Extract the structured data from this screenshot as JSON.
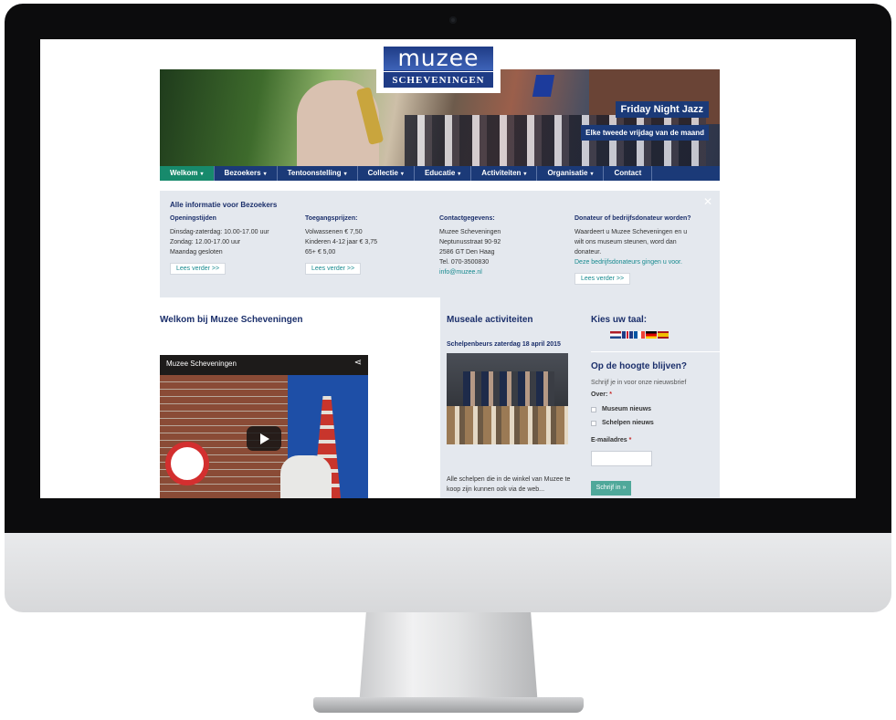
{
  "logo": {
    "word": "muzee",
    "sub": "SCHEVENINGEN"
  },
  "header": {
    "caption_title": "Friday Night Jazz",
    "caption_sub": "Elke tweede vrijdag van de maand"
  },
  "nav": {
    "items": [
      {
        "label": "Welkom",
        "caret": "▾"
      },
      {
        "label": "Bezoekers",
        "caret": "▾"
      },
      {
        "label": "Tentoonstelling",
        "caret": "▾"
      },
      {
        "label": "Collectie",
        "caret": "▾"
      },
      {
        "label": "Educatie",
        "caret": "▾"
      },
      {
        "label": "Activiteiten",
        "caret": "▾"
      },
      {
        "label": "Organisatie",
        "caret": "▾"
      },
      {
        "label": "Contact",
        "caret": ""
      }
    ],
    "active_color": "#178a6c",
    "bar_color": "#1b3a78"
  },
  "info": {
    "title": "Alle informatie voor Bezoekers",
    "close": "✕",
    "columns": [
      {
        "heading": "Openingstijden",
        "lines": [
          "Dinsdag-zaterdag: 10.00-17.00 uur",
          "Zondag: 12.00-17.00 uur",
          "Maandag gesloten"
        ],
        "link": "",
        "button": "Lees verder >>"
      },
      {
        "heading": "Toegangsprijzen:",
        "lines": [
          "Volwassenen € 7,50",
          "Kinderen 4-12 jaar € 3,75",
          "65+ € 5,00"
        ],
        "link": "",
        "button": "Lees verder >>"
      },
      {
        "heading": "Contactgegevens:",
        "lines": [
          "Muzee Scheveningen",
          "Neptunusstraat 90-92",
          "2586 GT Den Haag",
          "Tel. 070-3500830"
        ],
        "link": "info@muzee.nl",
        "button": ""
      },
      {
        "heading": "Donateur of bedrijfsdonateur worden?",
        "lines": [
          "Waardeert u Muzee Scheveningen en u",
          "wilt ons museum steunen, word dan",
          "donateur."
        ],
        "link": "Deze bedrijfsdonateurs gingen u voor.",
        "button": "Lees verder >>"
      }
    ]
  },
  "welcome": {
    "title": "Welkom bij Muzee Scheveningen",
    "video_title": "Muzee Scheveningen",
    "share_icon": "share-icon",
    "play_icon": "play-icon"
  },
  "activities": {
    "title": "Museale activiteiten",
    "event_title": "Schelpenbeurs zaterdag 18 april 2015",
    "event_text": "Alle schelpen die in de winkel van Muzee te koop zijn kunnen ook via de web..."
  },
  "sidebar": {
    "lang_title": "Kies uw taal:",
    "languages": [
      "nl",
      "en",
      "fr",
      "de",
      "es"
    ],
    "nl_title": "Op de hoogte blijven?",
    "nl_intro": "Schrijf je in voor onze nieuwsbrief",
    "about_label": "Over:",
    "required_mark": "*",
    "options": [
      "Museum nieuws",
      "Schelpen nieuws"
    ],
    "email_label": "E-mailadres",
    "submit_label": "Schrijf in »"
  }
}
